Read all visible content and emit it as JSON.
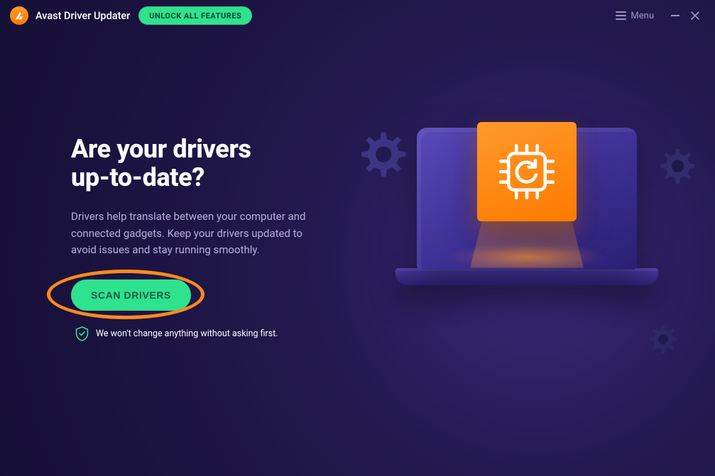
{
  "header": {
    "app_title": "Avast Driver Updater",
    "unlock_label": "UNLOCK ALL FEATURES",
    "menu_label": "Menu"
  },
  "main": {
    "heading_line1": "Are your drivers",
    "heading_line2": "up-to-date?",
    "description": "Drivers help translate between your computer and connected gadgets. Keep your drivers updated to avoid issues and stay running smoothly.",
    "scan_button": "SCAN DRIVERS",
    "assurance": "We won't change anything without asking first."
  },
  "colors": {
    "accent_green": "#2fe28e",
    "accent_orange": "#ff8a1f"
  }
}
